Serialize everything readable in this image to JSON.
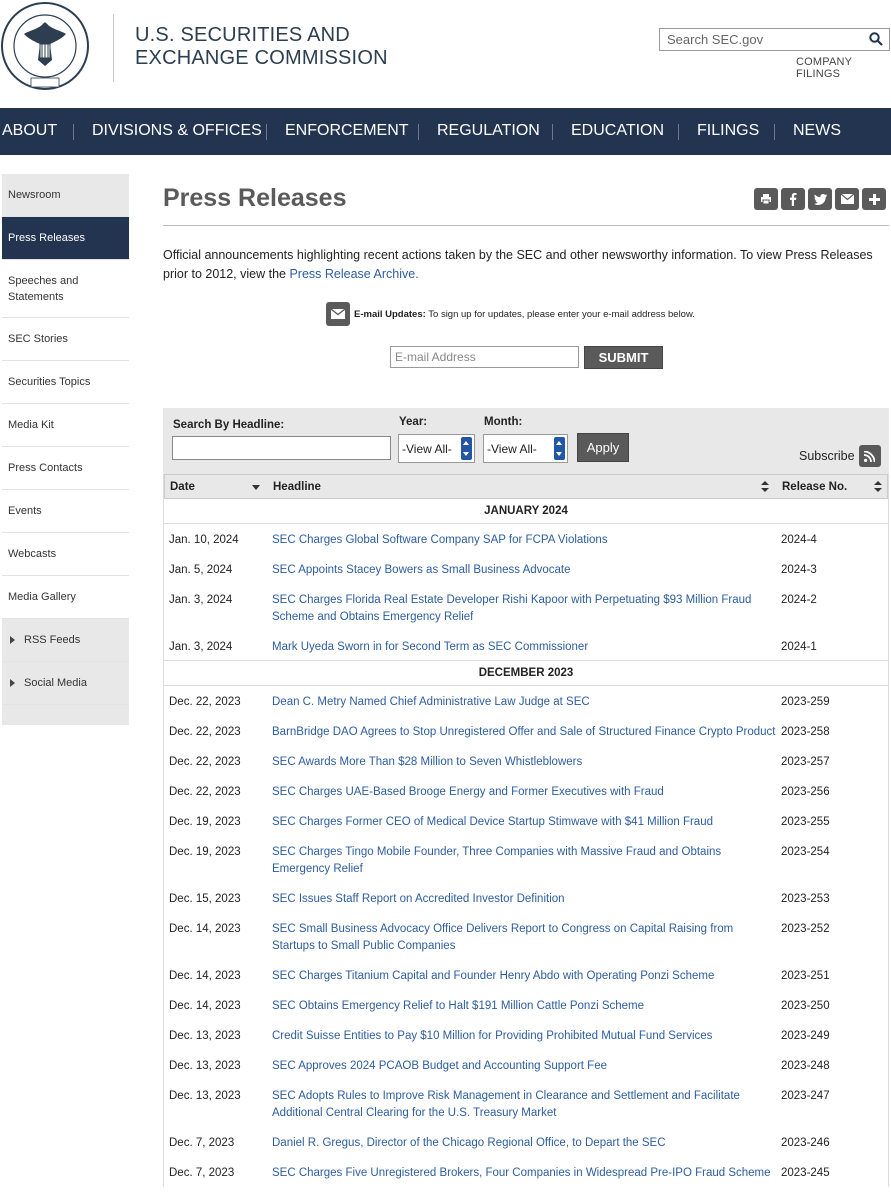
{
  "header": {
    "agency_line1": "U.S. SECURITIES AND",
    "agency_line2": "EXCHANGE COMMISSION",
    "seal_text": "U.S. SECURITIES AND EXCHANGE COMMISSION",
    "seal_year": "MCMXXXIV",
    "search_placeholder": "Search SEC.gov",
    "company_filings": "COMPANY FILINGS"
  },
  "nav": [
    "ABOUT",
    "DIVISIONS & OFFICES",
    "ENFORCEMENT",
    "REGULATION",
    "EDUCATION",
    "FILINGS",
    "NEWS"
  ],
  "sidebar": [
    {
      "label": "Newsroom"
    },
    {
      "label": "Press Releases"
    },
    {
      "label": "Speeches and Statements"
    },
    {
      "label": "SEC Stories"
    },
    {
      "label": "Securities Topics"
    },
    {
      "label": "Media Kit"
    },
    {
      "label": "Press Contacts"
    },
    {
      "label": "Events"
    },
    {
      "label": "Webcasts"
    },
    {
      "label": "Media Gallery"
    },
    {
      "label": "RSS Feeds"
    },
    {
      "label": "Social Media"
    }
  ],
  "main": {
    "title": "Press Releases",
    "intro": "Official announcements highlighting recent actions taken by the SEC and other newsworthy information.  To view Press Releases prior to 2012, view the ",
    "intro_link": "Press Release Archive.",
    "email_label": "E-mail Updates:",
    "email_text": " To sign up for updates, please enter your e-mail address below.",
    "email_placeholder": "E-mail Address",
    "submit": "SUBMIT"
  },
  "filter": {
    "headline_label": "Search By Headline:",
    "year_label": "Year:",
    "month_label": "Month:",
    "year_value": "-View All-",
    "month_value": "-View All-",
    "apply": "Apply",
    "subscribe": "Subscribe"
  },
  "table": {
    "headers": [
      "Date",
      "Headline",
      "Release No."
    ],
    "groups": [
      {
        "month": "JANUARY 2024",
        "rows": [
          {
            "date": "Jan. 10, 2024",
            "headline": "SEC Charges Global Software Company SAP for FCPA Violations",
            "release": "2024-4"
          },
          {
            "date": "Jan. 5, 2024",
            "headline": "SEC Appoints Stacey Bowers as Small Business Advocate",
            "release": "2024-3"
          },
          {
            "date": "Jan. 3, 2024",
            "headline": "SEC Charges Florida Real Estate Developer Rishi Kapoor with Perpetuating $93 Million Fraud Scheme and Obtains Emergency Relief",
            "release": "2024-2"
          },
          {
            "date": "Jan. 3, 2024",
            "headline": "Mark Uyeda Sworn in for Second Term as SEC Commissioner",
            "release": "2024-1"
          }
        ]
      },
      {
        "month": "DECEMBER 2023",
        "rows": [
          {
            "date": "Dec. 22, 2023",
            "headline": "Dean C. Metry Named Chief Administrative Law Judge at SEC",
            "release": "2023-259"
          },
          {
            "date": "Dec. 22, 2023",
            "headline": "BarnBridge DAO Agrees to Stop Unregistered Offer and Sale of Structured Finance Crypto Product",
            "release": "2023-258"
          },
          {
            "date": "Dec. 22, 2023",
            "headline": "SEC Awards More Than $28 Million to Seven Whistleblowers",
            "release": "2023-257"
          },
          {
            "date": "Dec. 22, 2023",
            "headline": "SEC Charges UAE-Based Brooge Energy and Former Executives with Fraud",
            "release": "2023-256"
          },
          {
            "date": "Dec. 19, 2023",
            "headline": "SEC Charges Former CEO of Medical Device Startup Stimwave with $41 Million Fraud",
            "release": "2023-255"
          },
          {
            "date": "Dec. 19, 2023",
            "headline": "SEC Charges Tingo Mobile Founder, Three Companies with Massive Fraud and Obtains Emergency Relief",
            "release": "2023-254"
          },
          {
            "date": "Dec. 15, 2023",
            "headline": "SEC Issues Staff Report on Accredited Investor Definition",
            "release": "2023-253"
          },
          {
            "date": "Dec. 14, 2023",
            "headline": "SEC Small Business Advocacy Office Delivers Report to Congress on Capital Raising from Startups to Small Public Companies",
            "release": "2023-252"
          },
          {
            "date": "Dec. 14, 2023",
            "headline": "SEC Charges Titanium Capital and Founder Henry Abdo with Operating Ponzi Scheme",
            "release": "2023-251"
          },
          {
            "date": "Dec. 14, 2023",
            "headline": "SEC Obtains Emergency Relief to Halt $191 Million Cattle Ponzi Scheme",
            "release": "2023-250"
          },
          {
            "date": "Dec. 13, 2023",
            "headline": "Credit Suisse Entities to Pay $10 Million for Providing Prohibited Mutual Fund Services",
            "release": "2023-249"
          },
          {
            "date": "Dec. 13, 2023",
            "headline": "SEC Approves 2024 PCAOB Budget and Accounting Support Fee",
            "release": "2023-248"
          },
          {
            "date": "Dec. 13, 2023",
            "headline": "SEC Adopts Rules to Improve Risk Management in Clearance and Settlement and Facilitate Additional Central Clearing for the U.S. Treasury Market",
            "release": "2023-247"
          },
          {
            "date": "Dec. 7, 2023",
            "headline": "Daniel R. Gregus, Director of the Chicago Regional Office, to Depart the SEC",
            "release": "2023-246"
          },
          {
            "date": "Dec. 7, 2023",
            "headline": "SEC Charges Five Unregistered Brokers, Four Companies in Widespread Pre-IPO Fraud Scheme",
            "release": "2023-245"
          }
        ]
      }
    ]
  }
}
